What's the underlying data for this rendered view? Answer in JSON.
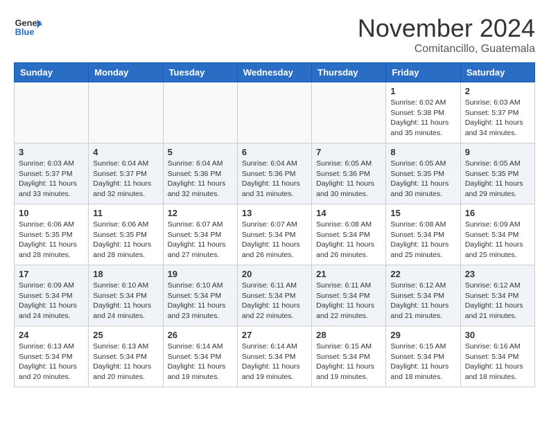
{
  "header": {
    "logo_line1": "General",
    "logo_line2": "Blue",
    "month": "November 2024",
    "location": "Comitancillo, Guatemala"
  },
  "weekdays": [
    "Sunday",
    "Monday",
    "Tuesday",
    "Wednesday",
    "Thursday",
    "Friday",
    "Saturday"
  ],
  "weeks": [
    [
      {
        "day": "",
        "info": ""
      },
      {
        "day": "",
        "info": ""
      },
      {
        "day": "",
        "info": ""
      },
      {
        "day": "",
        "info": ""
      },
      {
        "day": "",
        "info": ""
      },
      {
        "day": "1",
        "info": "Sunrise: 6:02 AM\nSunset: 5:38 PM\nDaylight: 11 hours\nand 35 minutes."
      },
      {
        "day": "2",
        "info": "Sunrise: 6:03 AM\nSunset: 5:37 PM\nDaylight: 11 hours\nand 34 minutes."
      }
    ],
    [
      {
        "day": "3",
        "info": "Sunrise: 6:03 AM\nSunset: 5:37 PM\nDaylight: 11 hours\nand 33 minutes."
      },
      {
        "day": "4",
        "info": "Sunrise: 6:04 AM\nSunset: 5:37 PM\nDaylight: 11 hours\nand 32 minutes."
      },
      {
        "day": "5",
        "info": "Sunrise: 6:04 AM\nSunset: 5:36 PM\nDaylight: 11 hours\nand 32 minutes."
      },
      {
        "day": "6",
        "info": "Sunrise: 6:04 AM\nSunset: 5:36 PM\nDaylight: 11 hours\nand 31 minutes."
      },
      {
        "day": "7",
        "info": "Sunrise: 6:05 AM\nSunset: 5:36 PM\nDaylight: 11 hours\nand 30 minutes."
      },
      {
        "day": "8",
        "info": "Sunrise: 6:05 AM\nSunset: 5:35 PM\nDaylight: 11 hours\nand 30 minutes."
      },
      {
        "day": "9",
        "info": "Sunrise: 6:05 AM\nSunset: 5:35 PM\nDaylight: 11 hours\nand 29 minutes."
      }
    ],
    [
      {
        "day": "10",
        "info": "Sunrise: 6:06 AM\nSunset: 5:35 PM\nDaylight: 11 hours\nand 28 minutes."
      },
      {
        "day": "11",
        "info": "Sunrise: 6:06 AM\nSunset: 5:35 PM\nDaylight: 11 hours\nand 28 minutes."
      },
      {
        "day": "12",
        "info": "Sunrise: 6:07 AM\nSunset: 5:34 PM\nDaylight: 11 hours\nand 27 minutes."
      },
      {
        "day": "13",
        "info": "Sunrise: 6:07 AM\nSunset: 5:34 PM\nDaylight: 11 hours\nand 26 minutes."
      },
      {
        "day": "14",
        "info": "Sunrise: 6:08 AM\nSunset: 5:34 PM\nDaylight: 11 hours\nand 26 minutes."
      },
      {
        "day": "15",
        "info": "Sunrise: 6:08 AM\nSunset: 5:34 PM\nDaylight: 11 hours\nand 25 minutes."
      },
      {
        "day": "16",
        "info": "Sunrise: 6:09 AM\nSunset: 5:34 PM\nDaylight: 11 hours\nand 25 minutes."
      }
    ],
    [
      {
        "day": "17",
        "info": "Sunrise: 6:09 AM\nSunset: 5:34 PM\nDaylight: 11 hours\nand 24 minutes."
      },
      {
        "day": "18",
        "info": "Sunrise: 6:10 AM\nSunset: 5:34 PM\nDaylight: 11 hours\nand 24 minutes."
      },
      {
        "day": "19",
        "info": "Sunrise: 6:10 AM\nSunset: 5:34 PM\nDaylight: 11 hours\nand 23 minutes."
      },
      {
        "day": "20",
        "info": "Sunrise: 6:11 AM\nSunset: 5:34 PM\nDaylight: 11 hours\nand 22 minutes."
      },
      {
        "day": "21",
        "info": "Sunrise: 6:11 AM\nSunset: 5:34 PM\nDaylight: 11 hours\nand 22 minutes."
      },
      {
        "day": "22",
        "info": "Sunrise: 6:12 AM\nSunset: 5:34 PM\nDaylight: 11 hours\nand 21 minutes."
      },
      {
        "day": "23",
        "info": "Sunrise: 6:12 AM\nSunset: 5:34 PM\nDaylight: 11 hours\nand 21 minutes."
      }
    ],
    [
      {
        "day": "24",
        "info": "Sunrise: 6:13 AM\nSunset: 5:34 PM\nDaylight: 11 hours\nand 20 minutes."
      },
      {
        "day": "25",
        "info": "Sunrise: 6:13 AM\nSunset: 5:34 PM\nDaylight: 11 hours\nand 20 minutes."
      },
      {
        "day": "26",
        "info": "Sunrise: 6:14 AM\nSunset: 5:34 PM\nDaylight: 11 hours\nand 19 minutes."
      },
      {
        "day": "27",
        "info": "Sunrise: 6:14 AM\nSunset: 5:34 PM\nDaylight: 11 hours\nand 19 minutes."
      },
      {
        "day": "28",
        "info": "Sunrise: 6:15 AM\nSunset: 5:34 PM\nDaylight: 11 hours\nand 19 minutes."
      },
      {
        "day": "29",
        "info": "Sunrise: 6:15 AM\nSunset: 5:34 PM\nDaylight: 11 hours\nand 18 minutes."
      },
      {
        "day": "30",
        "info": "Sunrise: 6:16 AM\nSunset: 5:34 PM\nDaylight: 11 hours\nand 18 minutes."
      }
    ]
  ]
}
